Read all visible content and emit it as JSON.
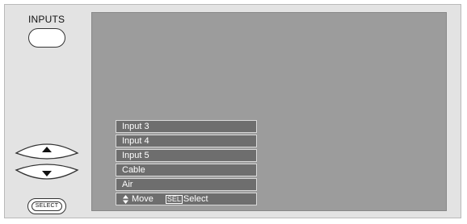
{
  "remote": {
    "inputs_label": "INPUTS",
    "select_label": "SELECT"
  },
  "menu": {
    "items": [
      {
        "label": "Input 3"
      },
      {
        "label": "Input 4"
      },
      {
        "label": "Input 5"
      },
      {
        "label": "Cable"
      },
      {
        "label": "Air"
      }
    ],
    "help": {
      "move_label": "Move",
      "sel_key": "SEL",
      "select_label": "Select"
    }
  },
  "icons": {
    "up": "up-arrow-icon",
    "down": "down-arrow-icon",
    "updown": "up-down-arrows-icon"
  },
  "colors": {
    "panel": "#e3e3e3",
    "screen": "#9c9c9c",
    "menu_item": "#6e6e6e",
    "menu_border": "#d9d9d9"
  }
}
